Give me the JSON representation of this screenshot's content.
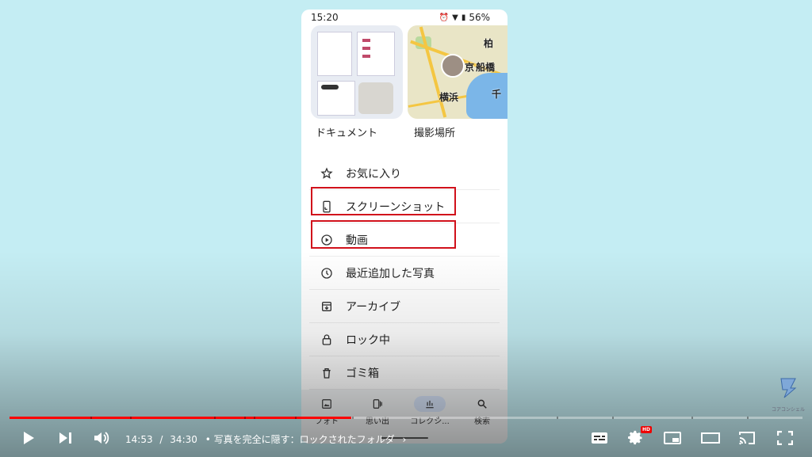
{
  "phone": {
    "status_time": "15:20",
    "battery": "56%",
    "thumbs": [
      {
        "label": "ドキュメント"
      },
      {
        "label": "撮影場所"
      }
    ],
    "map_labels": [
      "柏",
      "京",
      "船橋",
      "横浜",
      "千"
    ],
    "menu": [
      {
        "label": "お気に入り",
        "icon": "star-icon",
        "highlighted": false
      },
      {
        "label": "スクリーンショット",
        "icon": "phone-screenshot-icon",
        "highlighted": true
      },
      {
        "label": "動画",
        "icon": "play-circle-icon",
        "highlighted": true
      },
      {
        "label": "最近追加した写真",
        "icon": "clock-icon",
        "highlighted": false
      },
      {
        "label": "アーカイブ",
        "icon": "archive-icon",
        "highlighted": false
      },
      {
        "label": "ロック中",
        "icon": "lock-icon",
        "highlighted": false
      },
      {
        "label": "ゴミ箱",
        "icon": "trash-icon",
        "highlighted": false
      }
    ],
    "nav": [
      {
        "label": "フォト",
        "icon": "photo-icon",
        "active": false
      },
      {
        "label": "思い出",
        "icon": "memories-icon",
        "active": false
      },
      {
        "label": "コレクシ...",
        "icon": "collections-icon",
        "active": true
      },
      {
        "label": "検索",
        "icon": "search-icon",
        "active": false
      }
    ]
  },
  "watermark": {
    "text": "コアコンシェル"
  },
  "player": {
    "current_time": "14:53",
    "duration": "34:30",
    "separator": "/",
    "chapter": "• 写真を完全に隠す：ロックされたフォルダ",
    "chapter_chevron": "›",
    "progress": 0.431,
    "hd_badge": "HD",
    "accent": "#ff0000"
  }
}
